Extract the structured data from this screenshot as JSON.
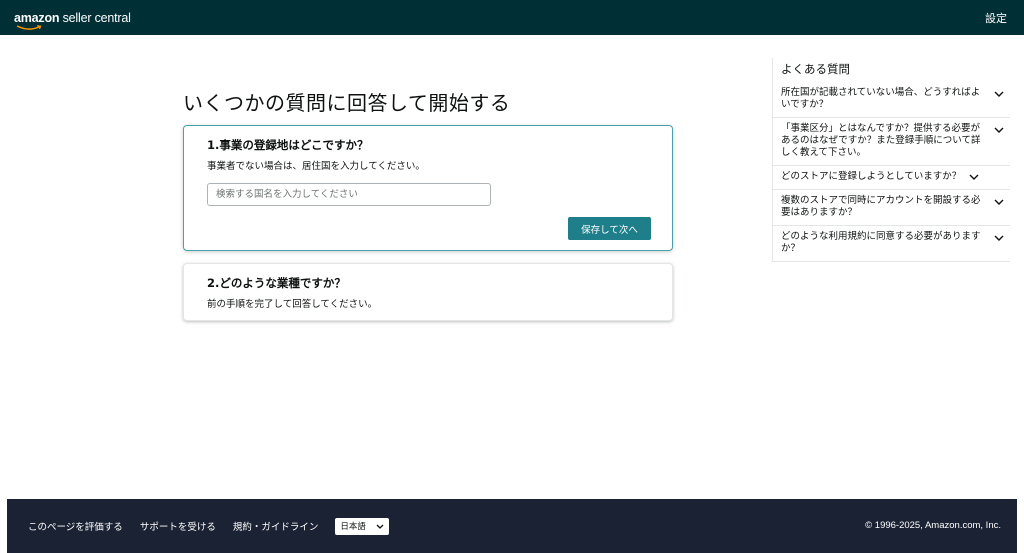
{
  "header": {
    "logo_brand": "amazon",
    "logo_suffix": "seller central",
    "settings_label": "設定"
  },
  "main": {
    "title": "いくつかの質問に回答して開始する",
    "step1": {
      "title": "1.事業の登録地はどこですか？",
      "description": "事業者でない場合は、居住国を入力してください。",
      "input_placeholder": "検索する国名を入力してください",
      "input_value": "",
      "save_label": "保存して次へ"
    },
    "step2": {
      "title": "2.どのような業種ですか？",
      "description": "前の手順を完了して回答してください。"
    }
  },
  "faq": {
    "title": "よくある質問",
    "items": [
      {
        "label": "所在国が記載されていない場合、どうすればよいですか？"
      },
      {
        "label": "「事業区分」とはなんですか？提供する必要があるのはなぜですか？また登録手順について詳しく教えて下さい。"
      },
      {
        "label": "どのストアに登録しようとしていますか？"
      },
      {
        "label": "複数のストアで同時にアカウントを開設する必要はありますか？"
      },
      {
        "label": "どのような利用規約に同意する必要がありますか？"
      }
    ]
  },
  "footer": {
    "rate_page": "このページを評価する",
    "get_support": "サポートを受ける",
    "policies": "規約・ガイドライン",
    "language": "日本語",
    "copyright": "© 1996-2025, Amazon.com, Inc."
  },
  "colors": {
    "header_bg": "#002f36",
    "accent_button": "#1e7e8a",
    "active_card_border": "#4a9fa8",
    "footer_bg": "#1a2233"
  },
  "icons": [
    "amazon-smile-icon",
    "chevron-down-icon"
  ]
}
